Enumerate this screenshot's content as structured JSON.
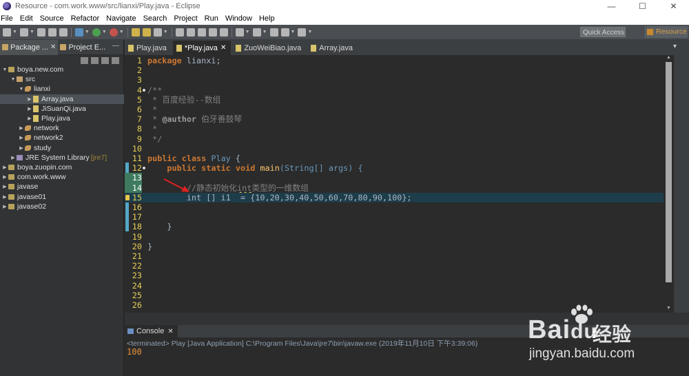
{
  "window": {
    "title": "Resource - com.work.www/src/lianxi/Play.java - Eclipse",
    "min": "—",
    "max": "☐",
    "close": "✕"
  },
  "menu": [
    "File",
    "Edit",
    "Source",
    "Refactor",
    "Navigate",
    "Search",
    "Project",
    "Run",
    "Window",
    "Help"
  ],
  "toolbar": {
    "quick_access_placeholder": "Quick Access",
    "perspective": "Resource"
  },
  "left_panel": {
    "tabs": [
      {
        "label": "Package ...",
        "close": "✕"
      },
      {
        "label": "Project E..."
      }
    ],
    "tree": [
      {
        "label": "boya.new.com",
        "arrow": "▼",
        "icon": "project-icon",
        "indent": 0
      },
      {
        "label": "src",
        "arrow": "▼",
        "icon": "source-folder-icon",
        "indent": 1
      },
      {
        "label": "lianxi",
        "arrow": "▼",
        "icon": "package-icon",
        "indent": 2
      },
      {
        "label": "Array.java",
        "arrow": "▶",
        "icon": "java-file-icon",
        "indent": 3,
        "selected": true
      },
      {
        "label": "JiSuanQi.java",
        "arrow": "▶",
        "icon": "java-file-icon",
        "indent": 3
      },
      {
        "label": "Play.java",
        "arrow": "▶",
        "icon": "java-file-icon",
        "indent": 3
      },
      {
        "label": "network",
        "arrow": "▶",
        "icon": "package-icon",
        "indent": 2
      },
      {
        "label": "network2",
        "arrow": "▶",
        "icon": "package-icon",
        "indent": 2
      },
      {
        "label": "study",
        "arrow": "▶",
        "icon": "package-icon",
        "indent": 2
      },
      {
        "label": "JRE System Library",
        "extra": "[jre7]",
        "arrow": "▶",
        "icon": "library-icon",
        "indent": 1
      },
      {
        "label": "boya.zuopin.com",
        "arrow": "▶",
        "icon": "project-icon",
        "indent": 0
      },
      {
        "label": "com.work.www",
        "arrow": "▶",
        "icon": "project-icon",
        "indent": 0
      },
      {
        "label": "javase",
        "arrow": "▶",
        "icon": "project-icon",
        "indent": 0
      },
      {
        "label": "javase01",
        "arrow": "▶",
        "icon": "project-icon",
        "indent": 0
      },
      {
        "label": "javase02",
        "arrow": "▶",
        "icon": "project-icon",
        "indent": 0
      }
    ]
  },
  "editor": {
    "tabs": [
      {
        "label": "Play.java",
        "active": false
      },
      {
        "label": "*Play.java",
        "active": true,
        "close": "✕"
      },
      {
        "label": "ZuoWeiBiao.java",
        "active": false
      },
      {
        "label": "Array.java",
        "active": false
      }
    ],
    "tab_menu": "▾",
    "line_numbers": [
      "1",
      "2",
      "3",
      "4",
      "5",
      "6",
      "7",
      "8",
      "9",
      "10",
      "11",
      "12",
      "13",
      "14",
      "15",
      "16",
      "17",
      "18",
      "19",
      "20",
      "21",
      "22",
      "23",
      "24",
      "25",
      "26"
    ],
    "code": {
      "l1_kw": "package",
      "l1_rest": " lianxi;",
      "l4": "/**",
      "l5": " * 百度经验--数组",
      "l6": " *",
      "l7_pre": " * ",
      "l7_tag": "@author",
      "l7_rest": " 伯牙善鼓琴",
      "l8": " *",
      "l9": " */",
      "l11_kw1": "public",
      "l11_kw2": "class",
      "l11_name": "Play",
      "l11_brace": " {",
      "l12_kw1": "public",
      "l12_kw2": "static",
      "l12_kw3": "void",
      "l12_fn": "main",
      "l12_args": "(String[] args) {",
      "l14_pre": "//静态初始化",
      "l14_int": "int",
      "l14_post": "类型的一维数组",
      "l15_code": "int [] i1  = {10,20,30,40,50,60,70,80,90,100};",
      "l18": "}",
      "l20": "}"
    }
  },
  "console": {
    "tab_label": "Console",
    "tab_close": "✕",
    "status": "<terminated> Play [Java Application] C:\\Program Files\\Java\\jre7\\bin\\javaw.exe (2019年11月10日 下午3:39:06)",
    "output": "100"
  },
  "watermark": {
    "logo": "Bai",
    "logo_suffix": "du",
    "cn": "经验",
    "url": "jingyan.baidu.com"
  }
}
